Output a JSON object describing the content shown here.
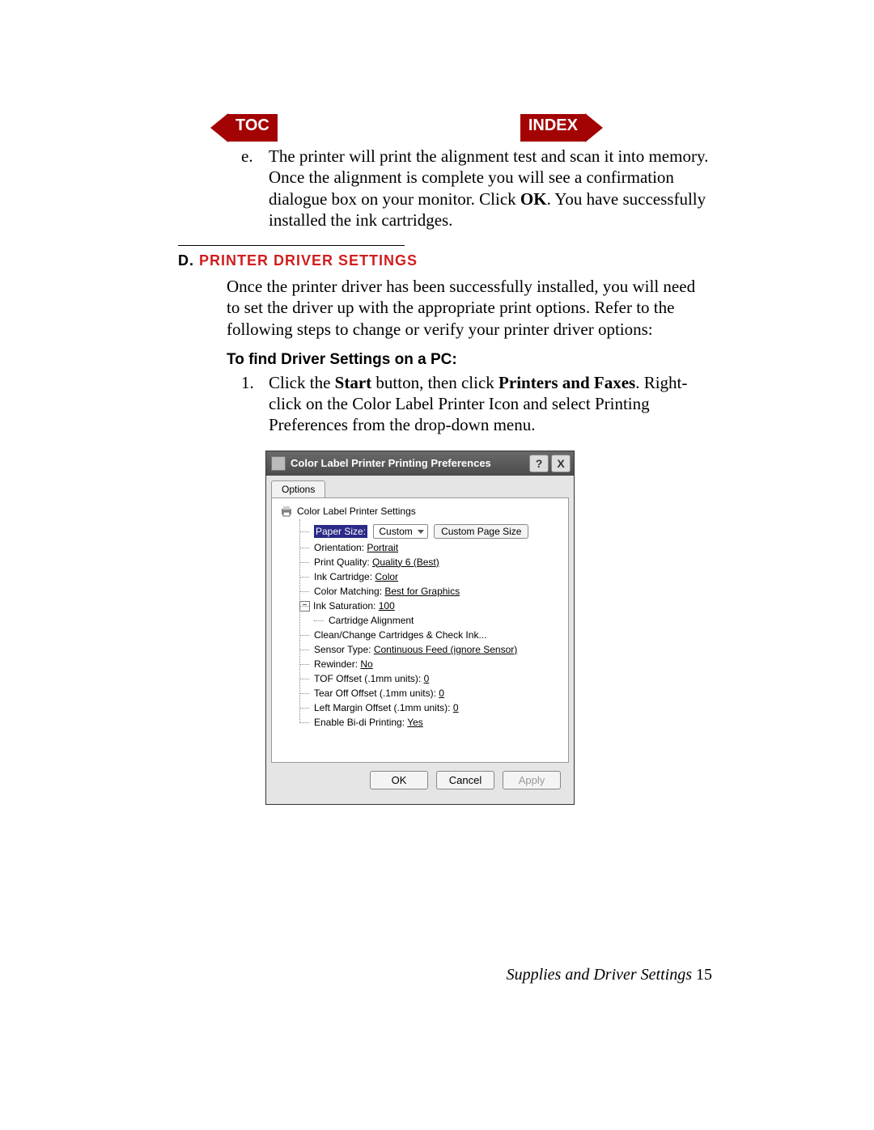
{
  "nav": {
    "toc": "TOC",
    "index": "INDEX"
  },
  "list_e": {
    "marker": "e.",
    "text": "The printer will print the alignment test and scan it into memory.  Once the alignment is complete you will see a confirmation dialogue box on your monitor.  Click ",
    "bold1": "OK",
    "text2": ".  You have successfully installed the ink cartridges."
  },
  "section": {
    "d": "D. ",
    "title": "PRINTER DRIVER SETTINGS",
    "para": "Once the printer driver has been successfully installed, you will need to set the driver up with the appropriate print options.  Refer to the following steps to change or verify your printer driver options:"
  },
  "sub": {
    "heading": "To find Driver Settings on a PC:",
    "step1": {
      "marker": "1.",
      "pre": "Click the ",
      "b1": "Start",
      "mid": " button, then click ",
      "b2": "Printers and Faxes",
      "post": ". Right-click on the Color Label Printer Icon and select Printing Preferences from the drop-down menu."
    }
  },
  "dialog": {
    "title": "Color Label Printer Printing Preferences",
    "tab": "Options",
    "root": "Color Label Printer Settings",
    "paper_size_label": "Paper Size:",
    "paper_size_value": "Custom",
    "custom_page_btn": "Custom Page Size",
    "rows": {
      "orientation_l": "Orientation: ",
      "orientation_v": "Portrait",
      "quality_l": "Print Quality: ",
      "quality_v": "Quality 6 (Best)",
      "ink_l": "Ink Cartridge: ",
      "ink_v": "Color",
      "match_l": "Color Matching: ",
      "match_v": "Best for Graphics",
      "sat_l": "Ink Saturation: ",
      "sat_v": "100",
      "cart_align": "Cartridge Alignment",
      "clean": "Clean/Change Cartridges & Check Ink...",
      "sensor_l": "Sensor Type: ",
      "sensor_v": "Continuous Feed (ignore Sensor)",
      "rewind_l": "Rewinder: ",
      "rewind_v": "No",
      "tof_l": "TOF Offset (.1mm units): ",
      "tof_v": "0",
      "tear_l": "Tear Off Offset (.1mm units): ",
      "tear_v": "0",
      "left_l": "Left Margin Offset (.1mm units): ",
      "left_v": "0",
      "bidi_l": "Enable Bi-di Printing: ",
      "bidi_v": "Yes"
    },
    "buttons": {
      "ok": "OK",
      "cancel": "Cancel",
      "apply": "Apply"
    },
    "help": "?",
    "close": "X"
  },
  "footer": {
    "text": "Supplies and Driver Settings ",
    "page": "15"
  }
}
